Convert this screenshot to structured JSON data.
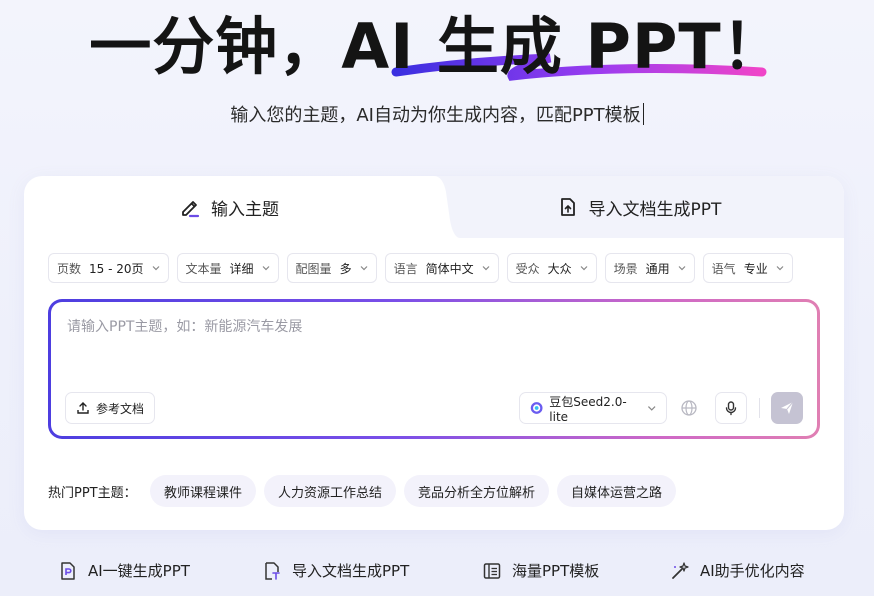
{
  "hero": {
    "title": "一分钟，AI 生成 PPT！",
    "subtitle": "输入您的主题，AI自动为你生成内容，匹配PPT模板"
  },
  "tabs": [
    {
      "label": "输入主题",
      "icon": "pen-icon",
      "active": true
    },
    {
      "label": "导入文档生成PPT",
      "icon": "document-upload-icon",
      "active": false
    }
  ],
  "params": [
    {
      "label": "页数",
      "value": "15 - 20页"
    },
    {
      "label": "文本量",
      "value": "详细"
    },
    {
      "label": "配图量",
      "value": "多"
    },
    {
      "label": "语言",
      "value": "简体中文"
    },
    {
      "label": "受众",
      "value": "大众"
    },
    {
      "label": "场景",
      "value": "通用"
    },
    {
      "label": "语气",
      "value": "专业"
    }
  ],
  "input": {
    "placeholder": "请输入PPT主题，如：新能源汽车发展",
    "value": ""
  },
  "toolbar": {
    "ref_label": "参考文档",
    "model_label": "豆包Seed2.0-lite"
  },
  "hot": {
    "label": "热门PPT主题：",
    "chips": [
      "教师课程课件",
      "人力资源工作总结",
      "竞品分析全方位解析",
      "自媒体运营之路"
    ]
  },
  "features": [
    {
      "label": "AI一键生成PPT",
      "icon": "ppt-file-icon"
    },
    {
      "label": "导入文档生成PPT",
      "icon": "document-import-icon"
    },
    {
      "label": "海量PPT模板",
      "icon": "template-list-icon"
    },
    {
      "label": "AI助手优化内容",
      "icon": "magic-wand-icon"
    }
  ],
  "colors": {
    "accent_start": "#4d3ee0",
    "accent_end": "#e07fb3",
    "send_disabled": "#c5c3d3"
  }
}
